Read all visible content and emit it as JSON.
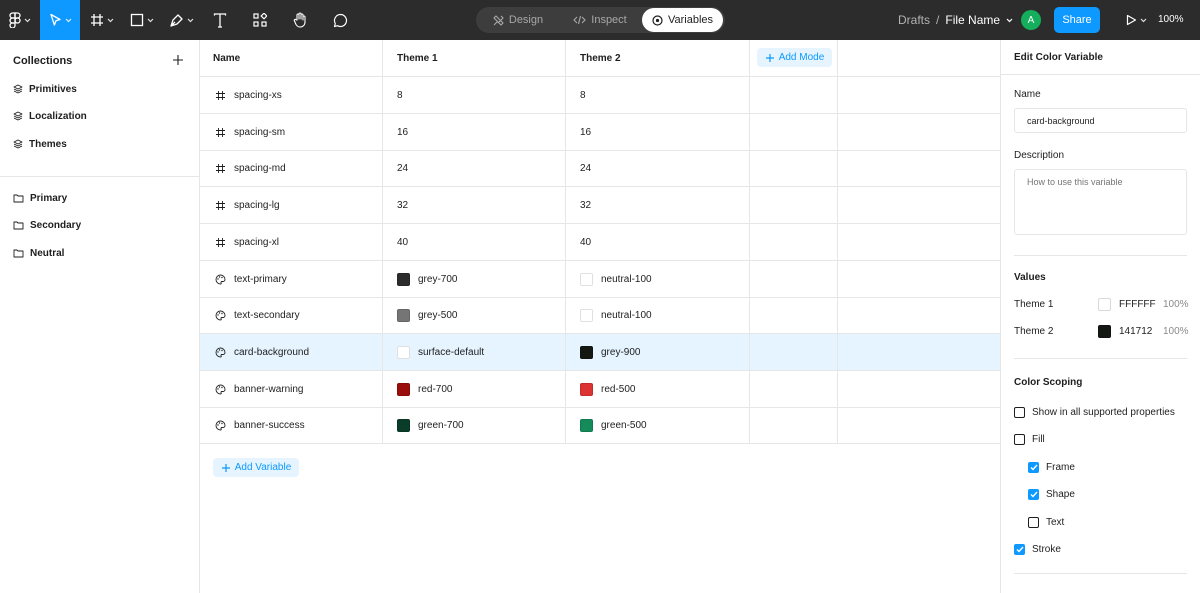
{
  "toolbar": {
    "modes": [
      {
        "label": "Design",
        "active": false
      },
      {
        "label": "Inspect",
        "active": false
      },
      {
        "label": "Variables",
        "active": true
      }
    ],
    "breadcrumb_parent": "Drafts",
    "breadcrumb_separator": "/",
    "file_name": "File Name",
    "avatar_initial": "A",
    "share_label": "Share",
    "zoom": "100%",
    "accent_color": "#0d99ff"
  },
  "collections": {
    "title": "Collections",
    "items": [
      {
        "label": "Primitives",
        "icon": "stack-icon"
      },
      {
        "label": "Localization",
        "icon": "stack-icon"
      },
      {
        "label": "Themes",
        "icon": "stack-icon"
      }
    ],
    "groups": [
      {
        "label": "Primary",
        "icon": "folder-icon"
      },
      {
        "label": "Secondary",
        "icon": "folder-icon"
      },
      {
        "label": "Neutral",
        "icon": "folder-icon"
      }
    ]
  },
  "table": {
    "headers": [
      "Name",
      "Theme 1",
      "Theme 2"
    ],
    "add_mode_label": "Add Mode",
    "add_variable_label": "Add Variable",
    "rows": [
      {
        "name": "spacing-xs",
        "type": "number",
        "t1": "8",
        "t2": "8"
      },
      {
        "name": "spacing-sm",
        "type": "number",
        "t1": "16",
        "t2": "16"
      },
      {
        "name": "spacing-md",
        "type": "number",
        "t1": "24",
        "t2": "24"
      },
      {
        "name": "spacing-lg",
        "type": "number",
        "t1": "32",
        "t2": "32"
      },
      {
        "name": "spacing-xl",
        "type": "number",
        "t1": "40",
        "t2": "40"
      },
      {
        "name": "text-primary",
        "type": "color",
        "t1": "grey-700",
        "t1_color": "#2c2c2c",
        "t2": "neutral-100",
        "t2_color": "#ffffff"
      },
      {
        "name": "text-secondary",
        "type": "color",
        "t1": "grey-500",
        "t1_color": "#757575",
        "t2": "neutral-100",
        "t2_color": "#ffffff"
      },
      {
        "name": "card-background",
        "type": "color",
        "selected": true,
        "t1": "surface-default",
        "t1_color": "#ffffff",
        "t2": "grey-900",
        "t2_color": "#141712"
      },
      {
        "name": "banner-warning",
        "type": "color",
        "t1": "red-700",
        "t1_color": "#9b0c0c",
        "t2": "red-500",
        "t2_color": "#dc3433"
      },
      {
        "name": "banner-success",
        "type": "color",
        "t1": "green-700",
        "t1_color": "#0a3d29",
        "t2": "green-500",
        "t2_color": "#158a5a"
      }
    ]
  },
  "editor": {
    "title": "Edit Color Variable",
    "name_label": "Name",
    "name_value": "card-background",
    "description_label": "Description",
    "description_placeholder": "How to use this variable",
    "values_label": "Values",
    "values": [
      {
        "mode": "Theme 1",
        "hex": "FFFFFF",
        "opacity": "100%",
        "color": "#ffffff"
      },
      {
        "mode": "Theme 2",
        "hex": "141712",
        "opacity": "100%",
        "color": "#141712"
      }
    ],
    "scoping_label": "Color Scoping",
    "scoping": [
      {
        "label": "Show in all supported properties",
        "checked": false,
        "indent": false
      },
      {
        "label": "Fill",
        "checked": false,
        "indent": false
      },
      {
        "label": "Frame",
        "checked": true,
        "indent": true
      },
      {
        "label": "Shape",
        "checked": true,
        "indent": true
      },
      {
        "label": "Text",
        "checked": false,
        "indent": true
      },
      {
        "label": "Stroke",
        "checked": true,
        "indent": false
      }
    ]
  }
}
